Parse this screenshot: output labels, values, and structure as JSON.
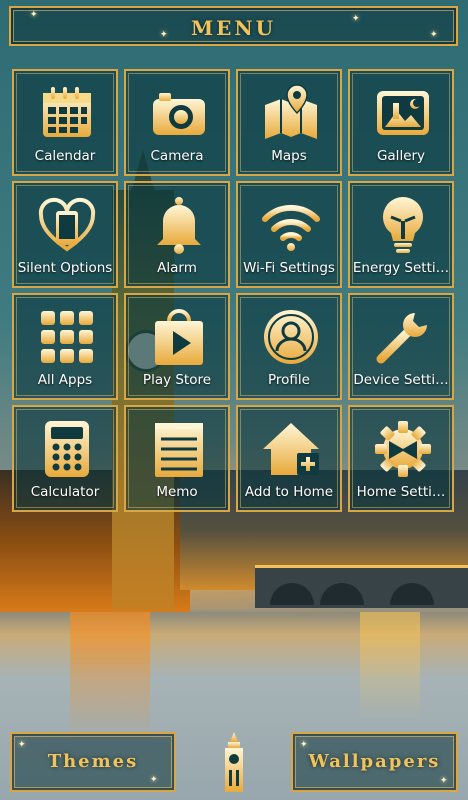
{
  "header": {
    "title": "MENU"
  },
  "tiles": [
    {
      "label": "Calendar",
      "icon": "calendar-icon"
    },
    {
      "label": "Camera",
      "icon": "camera-icon"
    },
    {
      "label": "Maps",
      "icon": "map-icon"
    },
    {
      "label": "Gallery",
      "icon": "gallery-icon"
    },
    {
      "label": "Silent Options",
      "icon": "heart-phone-icon"
    },
    {
      "label": "Alarm",
      "icon": "bell-icon"
    },
    {
      "label": "Wi-Fi Settings",
      "icon": "wifi-icon"
    },
    {
      "label": "Energy Setti…",
      "icon": "lightbulb-icon"
    },
    {
      "label": "All Apps",
      "icon": "app-grid-icon"
    },
    {
      "label": "Play Store",
      "icon": "play-store-icon"
    },
    {
      "label": "Profile",
      "icon": "profile-icon"
    },
    {
      "label": "Device Setti…",
      "icon": "wrench-icon"
    },
    {
      "label": "Calculator",
      "icon": "calculator-icon"
    },
    {
      "label": "Memo",
      "icon": "memo-icon"
    },
    {
      "label": "Add to Home",
      "icon": "add-home-icon"
    },
    {
      "label": "Home Setti…",
      "icon": "gear-icon"
    }
  ],
  "footer": {
    "themes_label": "Themes",
    "wallpapers_label": "Wallpapers",
    "logo_icon": "big-ben-icon"
  },
  "colors": {
    "gold": "#d9a646",
    "gold_text": "#f0c35c",
    "tile_bg": "#0a373e"
  }
}
